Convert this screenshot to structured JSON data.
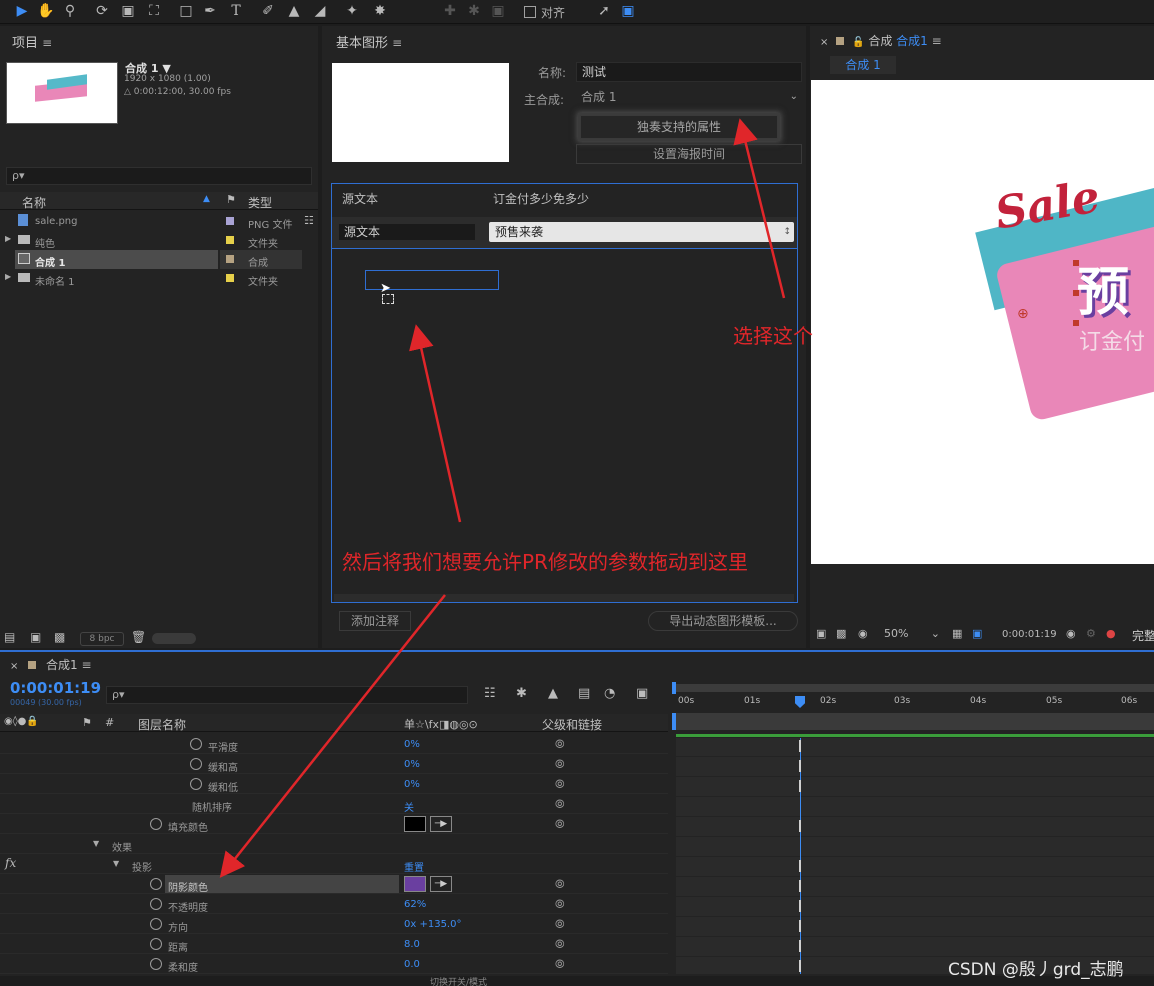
{
  "toolbar": {
    "align_label": "对齐"
  },
  "project": {
    "title": "项目",
    "comp_name": "合成 1 ▼",
    "comp_size": "1920 x 1080 (1.00)",
    "comp_duration": "△ 0:00:12:00, 30.00 fps",
    "search_placeholder": "ρ▾",
    "col_name": "名称",
    "col_type": "类型",
    "items": [
      {
        "name": "sale.png",
        "type": "PNG 文件",
        "color": "#a9a3d4"
      },
      {
        "name": "纯色",
        "type": "文件夹",
        "color": "#e6d04a"
      },
      {
        "name": "合成 1",
        "type": "合成",
        "color": "#b5a282"
      },
      {
        "name": "未命名 1",
        "type": "文件夹",
        "color": "#e6d04a"
      }
    ],
    "bpc": "8 bpc"
  },
  "essential": {
    "title": "基本图形",
    "name_label": "名称:",
    "name_value": "测试",
    "master_label": "主合成:",
    "master_value": "合成 1",
    "solo_btn": "独奏支持的属性",
    "poster_btn": "设置海报时间",
    "source_text_label": "源文本",
    "source_text_value": "订金付多少免多少",
    "prop_label": "源文本",
    "prop_value": "预售来袭",
    "add_comment": "添加注释",
    "export_btn": "导出动态图形模板..."
  },
  "annotations": {
    "select_this": "选择这个",
    "drag_here": "然后将我们想要允许PR修改的参数拖动到这里"
  },
  "composition": {
    "tab_prefix": "合成",
    "tab_name": "合成1",
    "sub_tab": "合成 1",
    "zoom": "50%",
    "timecode": "0:00:01:19",
    "quality": "完整",
    "preview_sale": "Sale",
    "preview_big": "预",
    "preview_sub": "订金付"
  },
  "timeline": {
    "tab_name": "合成1",
    "timecode": "0:00:01:19",
    "frames": "00049 (30.00 fps)",
    "search_placeholder": "ρ▾",
    "col_layer": "图层名称",
    "col_switches": "单☆\\fx◨◍◎⊙",
    "col_parent": "父级和链接",
    "ruler": [
      "00s",
      "01s",
      "02s",
      "03s",
      "04s",
      "05s",
      "06s"
    ],
    "rows": [
      {
        "label": "平滑度",
        "value": "0%"
      },
      {
        "label": "缓和高",
        "value": "0%"
      },
      {
        "label": "缓和低",
        "value": "0%"
      },
      {
        "label": "随机排序",
        "value": "关"
      },
      {
        "label": "填充颜色",
        "value": ""
      },
      {
        "label": "效果",
        "value": ""
      },
      {
        "label": "投影",
        "value": "重置"
      },
      {
        "label": "阴影颜色",
        "value": ""
      },
      {
        "label": "不透明度",
        "value": "62%"
      },
      {
        "label": "方向",
        "value": "0x +135.0°"
      },
      {
        "label": "距离",
        "value": "8.0"
      },
      {
        "label": "柔和度",
        "value": "0.0"
      }
    ],
    "fx_label": "fx",
    "bottom_label": "切换开关/模式"
  },
  "watermark": "CSDN @殷丿grd_志鹏",
  "colors": {
    "accent": "#3d8df5",
    "annotation": "#e0262a",
    "shadow_swatch": "#6a3fa0"
  }
}
